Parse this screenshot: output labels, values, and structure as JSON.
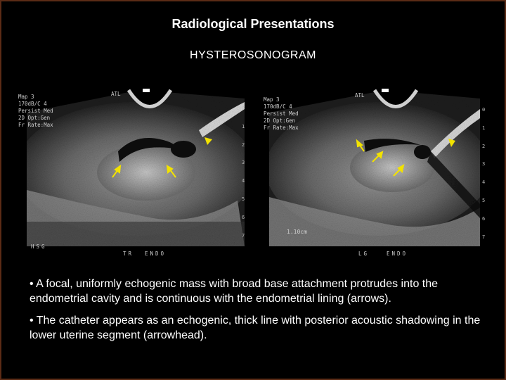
{
  "slide": {
    "title": "Radiological Presentations",
    "subtitle": "HYSTEROSONOGRAM",
    "bullets": [
      "• A focal, uniformly echogenic mass with broad base attachment protrudes into the endometrial cavity and is continuous with the endometrial lining (arrows).",
      "• The catheter appears as an echogenic, thick line with posterior acoustic shadowing in the lower uterine segment (arrowhead)."
    ]
  },
  "ultrasound": {
    "left": {
      "brand": "ATL",
      "settings": [
        "Map 3",
        "170dB/C 4",
        "Persist Med",
        "2D Opt:Gen",
        "Fr Rate:Max"
      ],
      "depth_marks": [
        "0",
        "1",
        "2",
        "3",
        "4",
        "5",
        "6",
        "7"
      ],
      "corner_label": "HSG",
      "plane_label": "TR",
      "region_label": "ENDO"
    },
    "right": {
      "brand": "ATL",
      "settings": [
        "Map 3",
        "170dB/C 4",
        "Persist Med",
        "2D Opt:Gen",
        "Fr Rate:Max"
      ],
      "depth_marks": [
        "0",
        "1",
        "2",
        "3",
        "4",
        "5",
        "6",
        "7"
      ],
      "measurement": "1.10cm",
      "plane_label": "LG",
      "region_label": "ENDO"
    },
    "arrow_color": "#f2e200"
  }
}
